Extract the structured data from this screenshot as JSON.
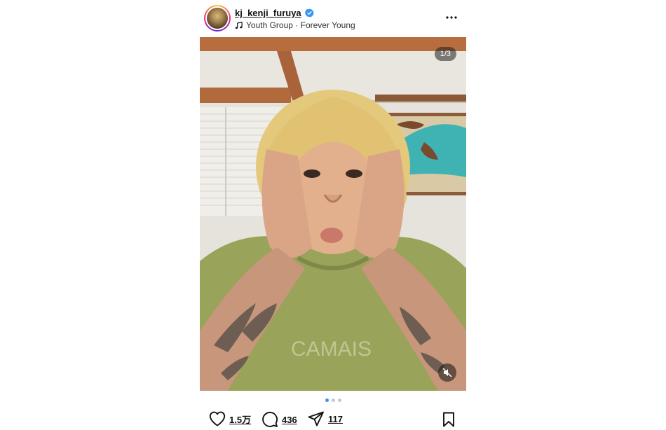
{
  "header": {
    "username": "kj_kenji_furuya",
    "music": "Youth Group · Forever Young"
  },
  "media": {
    "counter": "1/3",
    "slides_total": 3,
    "active_slide": 1
  },
  "actions": {
    "likes": "1.5万",
    "comments": "436",
    "shares": "117"
  },
  "colors": {
    "accent": "#3897f0",
    "verified": "#3897f0"
  },
  "icons": [
    "verified-icon",
    "music-note-icon",
    "more-options-icon",
    "mute-icon",
    "heart-icon",
    "comment-icon",
    "share-icon",
    "bookmark-icon"
  ]
}
